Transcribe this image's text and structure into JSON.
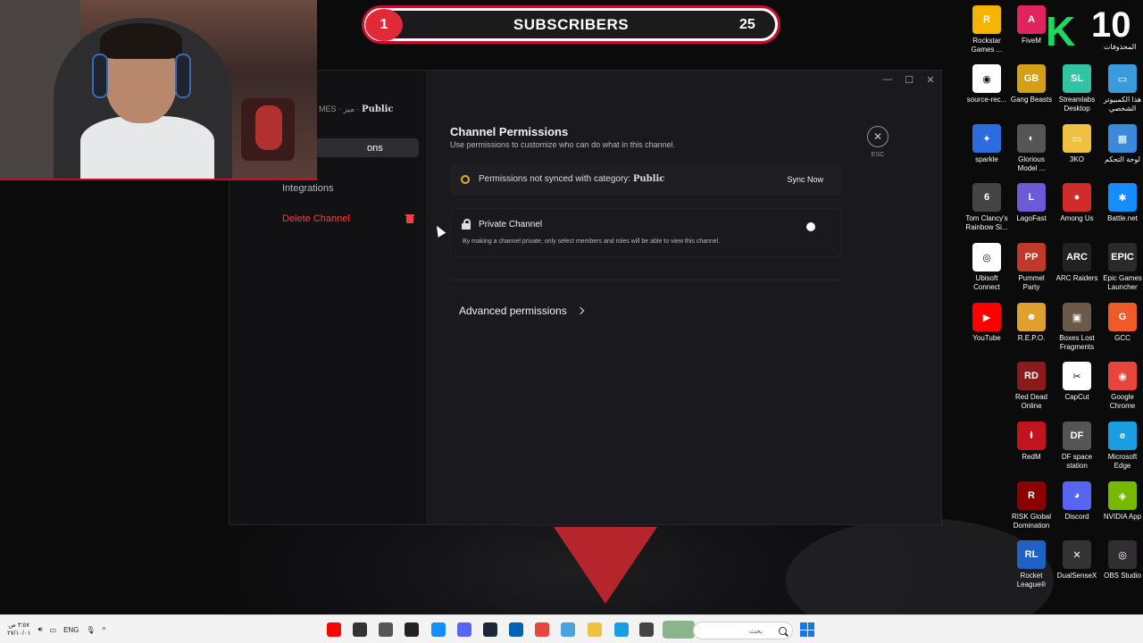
{
  "overlay": {
    "subscribers_left": "1",
    "subscribers_label": "SUBSCRIBERS",
    "subscribers_right": "25",
    "counter": "10",
    "counter_caption": "المحذوفات"
  },
  "discord": {
    "breadcrumb_prefix": "MES · ميز ·",
    "breadcrumb_channel": "Public",
    "sidebar": {
      "active_item": "ons",
      "integrations": "Integrations",
      "delete_channel": "Delete Channel"
    },
    "main": {
      "title": "Channel Permissions",
      "description": "Use permissions to customize who can do what in this channel.",
      "sync_text": "Permissions not synced with category:",
      "sync_category": "Public",
      "sync_button": "Sync Now",
      "private_title": "Private Channel",
      "private_desc": "By making a channel private, only select members and roles will be able to view this channel.",
      "private_enabled": false,
      "advanced": "Advanced permissions"
    },
    "esc_label": "ESC"
  },
  "desktop_icons": [
    {
      "label": "Rockstar Games ...",
      "color": "#f5b400",
      "glyph": "R"
    },
    {
      "label": "FiveM",
      "color": "#e0245e",
      "glyph": "A"
    },
    {
      "label": "source-rec...",
      "color": "#ffffff",
      "glyph": "◉"
    },
    {
      "label": "Gang Beasts",
      "color": "#d4a017",
      "glyph": "GB"
    },
    {
      "label": "Streamlabs Desktop",
      "color": "#31c3a2",
      "glyph": "SL"
    },
    {
      "label": "هذا الكمبيوتر الشخصي",
      "color": "#3a9bdc",
      "glyph": "▭"
    },
    {
      "label": "sparkle",
      "color": "#2d6cdf",
      "glyph": "✦"
    },
    {
      "label": "Glorious Model ...",
      "color": "#555555",
      "glyph": "◐"
    },
    {
      "label": "3KO",
      "color": "#f0c040",
      "glyph": "▭"
    },
    {
      "label": "لوحة التحكم",
      "color": "#3b8ad9",
      "glyph": "▦"
    },
    {
      "label": "Tom Clancy's Rainbow Si...",
      "color": "#444444",
      "glyph": "6"
    },
    {
      "label": "LagoFast",
      "color": "#6b5bd6",
      "glyph": "L"
    },
    {
      "label": "Among Us",
      "color": "#d22b2b",
      "glyph": "●"
    },
    {
      "label": "Battle.net",
      "color": "#148eff",
      "glyph": "✱"
    },
    {
      "label": "Ubisoft Connect",
      "color": "#ffffff",
      "glyph": "◎"
    },
    {
      "label": "Pummel Party",
      "color": "#c0392b",
      "glyph": "PP"
    },
    {
      "label": "ARC Raiders",
      "color": "#222222",
      "glyph": "ARC"
    },
    {
      "label": "Epic Games Launcher",
      "color": "#2a2a2a",
      "glyph": "EPIC"
    },
    {
      "label": "YouTube",
      "color": "#ff0000",
      "glyph": "▶"
    },
    {
      "label": "R.E.P.O.",
      "color": "#e0a030",
      "glyph": "☻"
    },
    {
      "label": "Boxes Lost Fragments",
      "color": "#6b5a48",
      "glyph": "▣"
    },
    {
      "label": "GCC",
      "color": "#f05a28",
      "glyph": "G"
    },
    {
      "label": "Red Dead Online",
      "color": "#8b1a1a",
      "glyph": "RD"
    },
    {
      "label": "CapCut",
      "color": "#ffffff",
      "glyph": "✂"
    },
    {
      "label": "Google Chrome",
      "color": "#e8453c",
      "glyph": "◉"
    },
    {
      "label": "RedM",
      "color": "#c0141e",
      "glyph": "ⱡ"
    },
    {
      "label": "DF space station",
      "color": "#555555",
      "glyph": "DF"
    },
    {
      "label": "Microsoft Edge",
      "color": "#1b9de2",
      "glyph": "e"
    },
    {
      "label": "RISK Global Domination",
      "color": "#8b0000",
      "glyph": "R"
    },
    {
      "label": "Discord",
      "color": "#5865f2",
      "glyph": "◕"
    },
    {
      "label": "NVIDIA App",
      "color": "#76b900",
      "glyph": "◈"
    },
    {
      "label": "Rocket League®",
      "color": "#1e63c4",
      "glyph": "RL"
    },
    {
      "label": "DualSenseX",
      "color": "#333333",
      "glyph": "✕"
    },
    {
      "label": "OBS Studio",
      "color": "#302e31",
      "glyph": "◎"
    }
  ],
  "taskbar": {
    "clock_time": "٣:٥٧ ص",
    "clock_date": "٢٧/١٠/٠١",
    "language": "ENG",
    "search_placeholder": "بحث"
  }
}
